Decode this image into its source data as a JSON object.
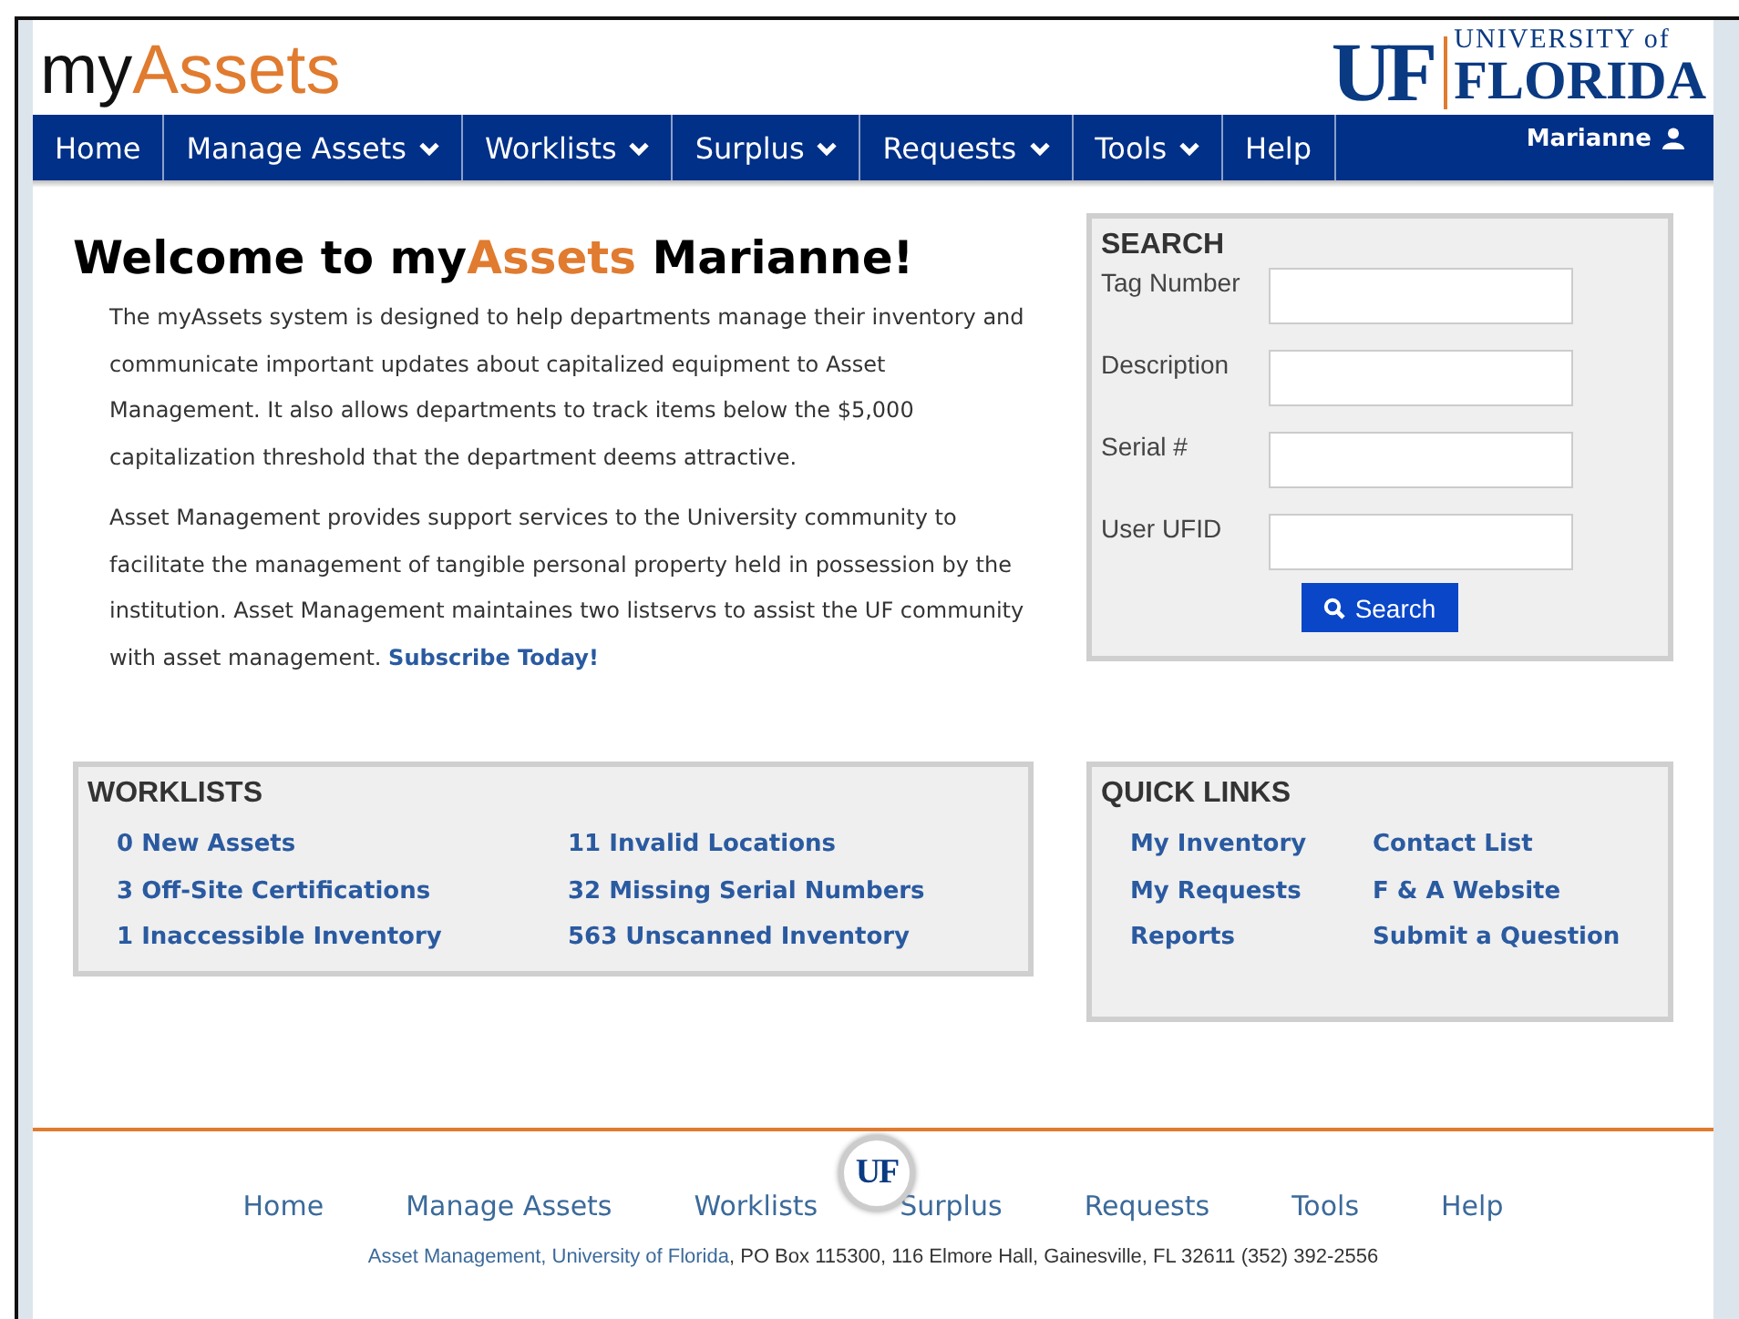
{
  "logo": {
    "prefix": "my",
    "highlight": "Assets"
  },
  "university_logo": {
    "mark": "UF",
    "line_1": "UNIVERSITY of",
    "line_2": "FLORIDA"
  },
  "nav": [
    {
      "label": "Home",
      "dropdown": false
    },
    {
      "label": "Manage Assets",
      "dropdown": true
    },
    {
      "label": "Worklists",
      "dropdown": true
    },
    {
      "label": "Surplus",
      "dropdown": true
    },
    {
      "label": "Requests",
      "dropdown": true
    },
    {
      "label": "Tools",
      "dropdown": true
    },
    {
      "label": "Help",
      "dropdown": false
    }
  ],
  "user": "Marianne",
  "welcome": {
    "prefix": "Welcome to my",
    "highlight": "Assets",
    "suffix": " Marianne!"
  },
  "intro": [
    "The myAssets system is designed to help departments manage their inventory and communicate important updates about capitalized equipment to Asset Management. It also allows departments to track items below the $5,000 capitalization threshold that the department deems attractive."
  ],
  "intro_2": {
    "text": "Asset Management provides support services to the University community to facilitate the management of tangible personal property held in possession by the institution. Asset Management maintaines two listservs to assist the UF community with asset management. ",
    "link": "Subscribe Today!"
  },
  "search": {
    "title": "SEARCH",
    "fields": [
      {
        "label": "Tag Number"
      },
      {
        "label": "Description"
      },
      {
        "label": "Serial #"
      },
      {
        "label": "User UFID"
      }
    ],
    "button": "Search"
  },
  "worklists": {
    "title": "WORKLISTS",
    "columns": [
      [
        "0 New Assets",
        "3 Off-Site Certifications",
        "1 Inaccessible Inventory"
      ],
      [
        "11 Invalid Locations",
        "32 Missing Serial Numbers",
        "563 Unscanned Inventory"
      ]
    ]
  },
  "quick_links": {
    "title": "QUICK LINKS",
    "columns": [
      [
        "My Inventory",
        "My Requests",
        "Reports"
      ],
      [
        "Contact List",
        "F & A Website",
        "Submit a Question"
      ]
    ]
  },
  "footer": {
    "badge": "UF",
    "nav": [
      "Home",
      "Manage Assets",
      "Worklists",
      "Surplus",
      "Requests",
      "Tools",
      "Help"
    ],
    "address_link": "Asset Management, University of Florida",
    "address": ", PO Box 115300, 116 Elmore Hall, Gainesville, FL 32611 (352) 392-2556"
  }
}
